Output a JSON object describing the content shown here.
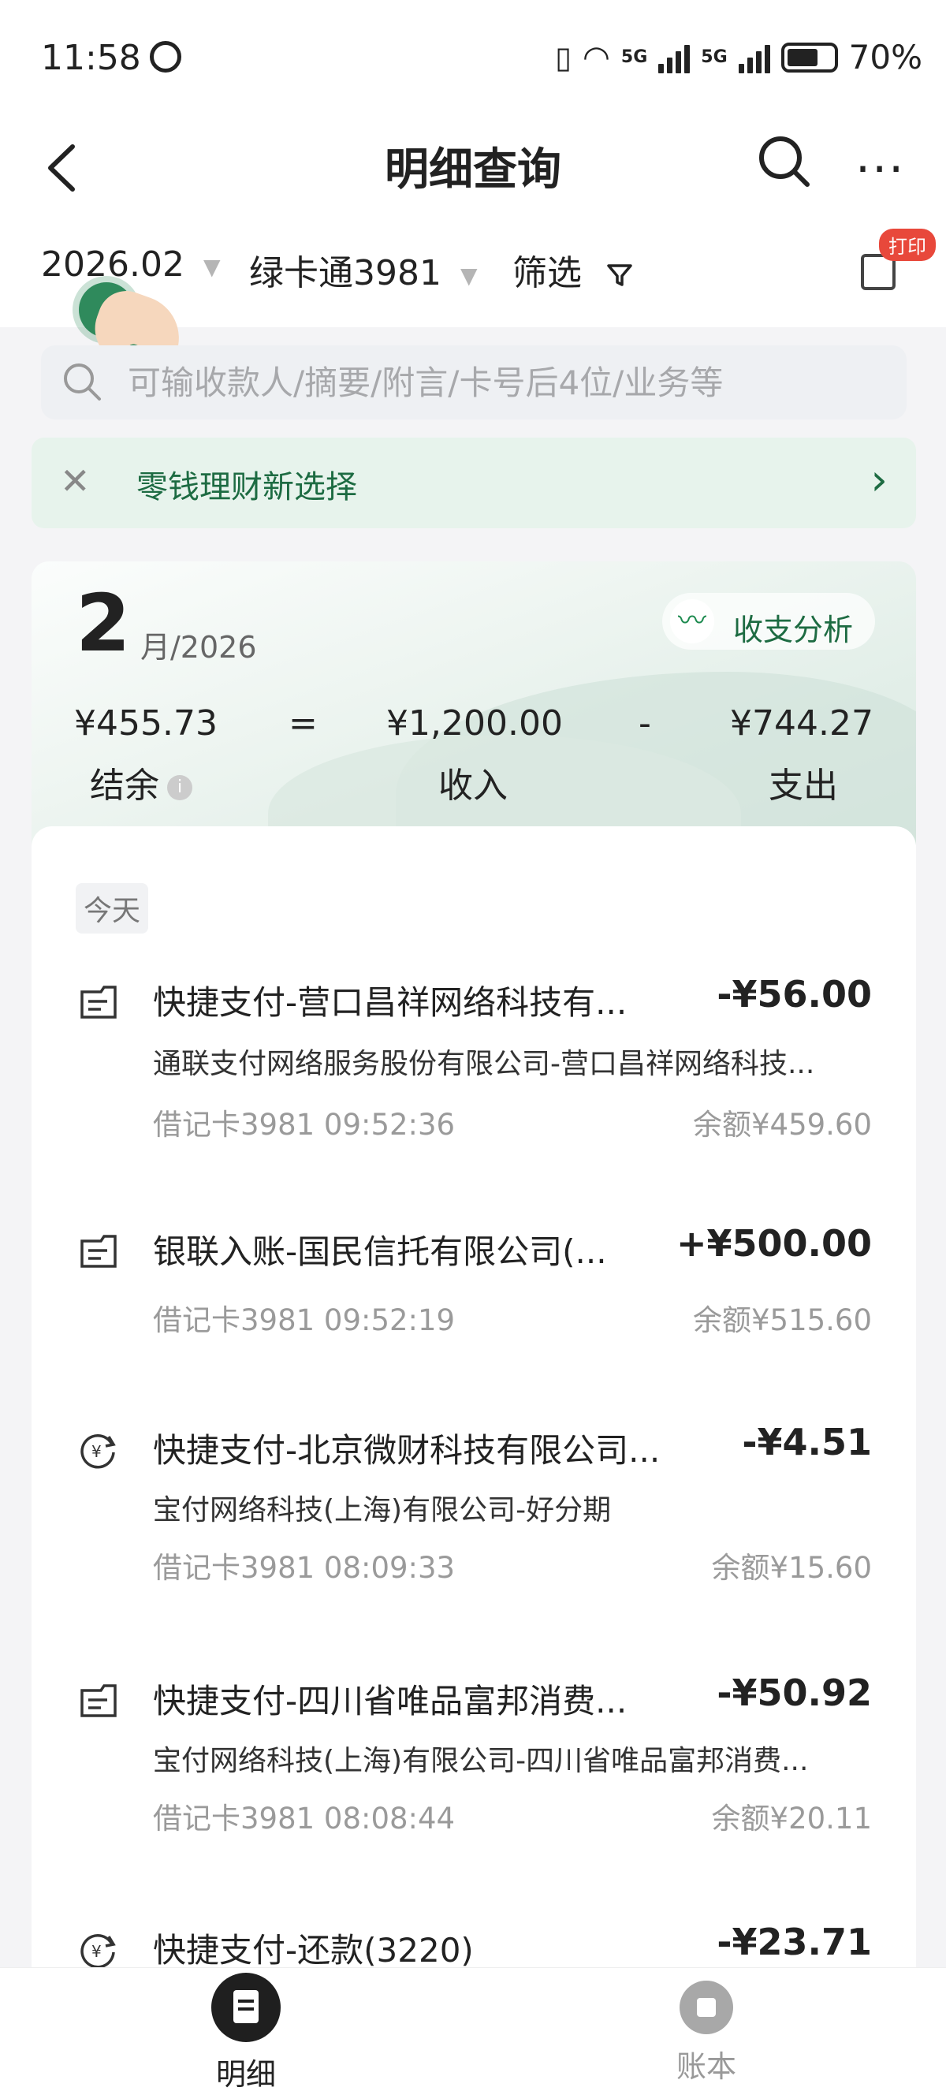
{
  "status_bar": {
    "time": "11:58",
    "network1": "5G",
    "network2": "5G",
    "battery": "70%"
  },
  "header": {
    "title": "明细查询"
  },
  "filters": {
    "date": "2026.02",
    "card": "绿卡通3981",
    "filter": "筛选",
    "print_badge": "打印"
  },
  "search": {
    "placeholder": "可输收款人/摘要/附言/卡号后4位/业务等"
  },
  "promo": {
    "text": "零钱理财新选择"
  },
  "summary": {
    "month": "2",
    "month_suffix": "月/2026",
    "analysis_label": "收支分析",
    "balance_amount": "¥455.73",
    "balance_label": "结余",
    "eq": "=",
    "income_amount": "¥1,200.00",
    "income_label": "收入",
    "minus": "-",
    "expense_amount": "¥744.27",
    "expense_label": "支出"
  },
  "list": {
    "section_label": "今天",
    "transactions": [
      {
        "icon": "receipt-icon",
        "title": "快捷支付-营口昌祥网络科技有...",
        "amount": "-¥56.00",
        "subtitle": "通联支付网络服务股份有限公司-营口昌祥网络科技...",
        "meta": "借记卡3981 09:52:36",
        "balance": "余额¥459.60"
      },
      {
        "icon": "receipt-icon",
        "title": "银联入账-国民信托有限公司(...",
        "amount": "+¥500.00",
        "subtitle": "",
        "meta": "借记卡3981 09:52:19",
        "balance": "余额¥515.60"
      },
      {
        "icon": "yuan-refresh-icon",
        "title": "快捷支付-北京微财科技有限公司...",
        "amount": "-¥4.51",
        "subtitle": "宝付网络科技(上海)有限公司-好分期",
        "meta": "借记卡3981 08:09:33",
        "balance": "余额¥15.60"
      },
      {
        "icon": "receipt-icon",
        "title": "快捷支付-四川省唯品富邦消费...",
        "amount": "-¥50.92",
        "subtitle": "宝付网络科技(上海)有限公司-四川省唯品富邦消费...",
        "meta": "借记卡3981 08:08:44",
        "balance": "余额¥20.11"
      },
      {
        "icon": "yuan-refresh-icon",
        "title": "快捷支付-还款(3220)",
        "amount": "-¥23.71",
        "subtitle": "",
        "meta": "",
        "balance": ""
      }
    ]
  },
  "bottom_nav": {
    "items": [
      {
        "label": "明细",
        "active": true
      },
      {
        "label": "账本",
        "active": false
      }
    ]
  },
  "colors": {
    "accent_green": "#1d6b42",
    "badge_red": "#e8483b"
  }
}
